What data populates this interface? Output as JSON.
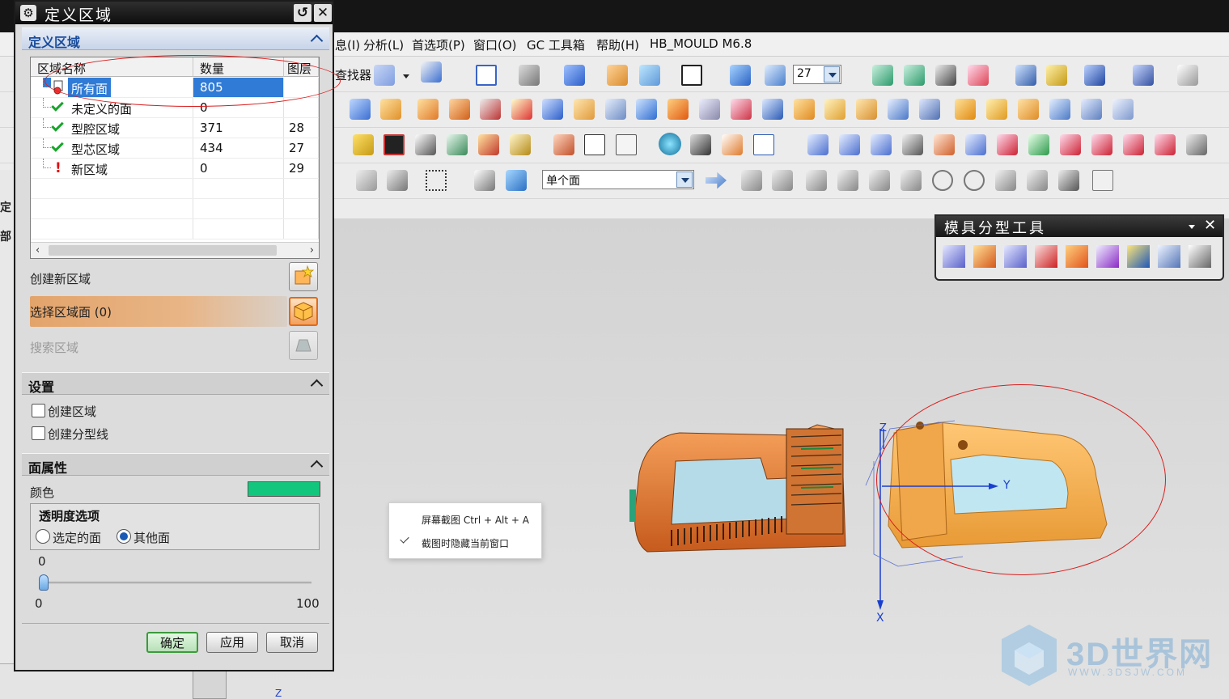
{
  "menubar": {
    "items": [
      "息(I)",
      "分析(L)",
      "首选项(P)",
      "窗口(O)",
      "GC 工具箱",
      "帮助(H)",
      "HB_MOULD M6.8"
    ]
  },
  "toolbar": {
    "finder_label": "查找器",
    "layer_value": "27",
    "selection_filter": "单个面"
  },
  "navigator": {
    "labels": [
      "定",
      "部"
    ]
  },
  "mould_palette": {
    "title": "模具分型工具",
    "close_glyph": "✕"
  },
  "context_menu": {
    "item1": "屏幕截图 Ctrl + Alt + A",
    "item2": "截图时隐藏当前窗口",
    "item2_checked": true
  },
  "dialog": {
    "title": "定义区域",
    "define_section": "定义区域",
    "columns": [
      "区域名称",
      "数量",
      "图层"
    ],
    "rows": [
      {
        "name": "所有面",
        "count": "805",
        "layer": "",
        "status": "all",
        "selected": true
      },
      {
        "name": "未定义的面",
        "count": "0",
        "layer": "",
        "status": "ok"
      },
      {
        "name": "型腔区域",
        "count": "371",
        "layer": "28",
        "status": "ok"
      },
      {
        "name": "型芯区域",
        "count": "434",
        "layer": "27",
        "status": "ok"
      },
      {
        "name": "新区域",
        "count": "0",
        "layer": "29",
        "status": "warn"
      }
    ],
    "create_region": "创建新区域",
    "select_faces": "选择区域面 (0)",
    "search_region": "搜索区域",
    "settings_section": "设置",
    "cb_create_region": "创建区域",
    "cb_create_parting": "创建分型线",
    "face_props_section": "面属性",
    "color_label": "颜色",
    "color_value": "#12c77d",
    "transparency_title": "透明度选项",
    "radio_selected": "选定的面",
    "radio_other": "其他面",
    "slider_value": "0",
    "slider_min": "0",
    "slider_max": "100",
    "btn_ok": "确定",
    "btn_apply": "应用",
    "btn_cancel": "取消"
  },
  "viewport": {
    "axis_y": "Y",
    "axis_x": "X",
    "axis_z": "Z"
  },
  "watermark": {
    "brand": "3D世界网",
    "url": "WWW.3DSJW.COM"
  }
}
